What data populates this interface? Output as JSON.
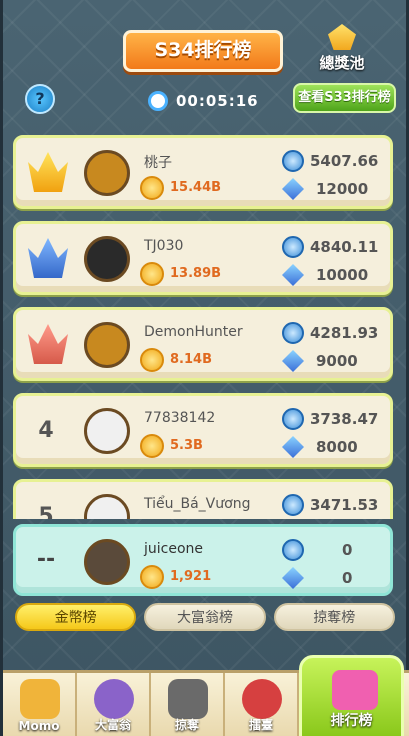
{
  "header": {
    "title": "S34排行榜",
    "pool_label": "總獎池",
    "help_label": "?",
    "timer": "00:05:16",
    "view_button": "查看S33排行榜"
  },
  "rows": [
    {
      "rank": "",
      "crown": "gold",
      "name": "桃子",
      "gold": "15.44B",
      "score": "5407.66",
      "gems": "12000",
      "avatar_color": "#c8891f"
    },
    {
      "rank": "",
      "crown": "silver",
      "name": "TJ030",
      "gold": "13.89B",
      "score": "4840.11",
      "gems": "10000",
      "avatar_color": "#2a2a2a"
    },
    {
      "rank": "",
      "crown": "bronze",
      "name": "DemonHunter",
      "gold": "8.14B",
      "score": "4281.93",
      "gems": "9000",
      "avatar_color": "#c8891f"
    },
    {
      "rank": "4",
      "crown": "",
      "name": "77838142",
      "gold": "5.3B",
      "score": "3738.47",
      "gems": "8000",
      "avatar_color": "#f0f0f0"
    },
    {
      "rank": "5",
      "crown": "",
      "name": "Tiểu_Bá_Vương",
      "gold": "",
      "score": "3471.53",
      "gems": "",
      "avatar_color": "#f0f0f0"
    }
  ],
  "self": {
    "rank": "--",
    "name": "juiceone",
    "gold": "1,921",
    "score": "0",
    "gems": "0"
  },
  "tabs": [
    {
      "label": "金幣榜",
      "active": true
    },
    {
      "label": "大富翁榜",
      "active": false
    },
    {
      "label": "掠奪榜",
      "active": false
    }
  ],
  "nav": [
    {
      "label": "Momo",
      "color": "#f0b43a"
    },
    {
      "label": "大富翁",
      "color": "#8a63c9"
    },
    {
      "label": "掠奪",
      "color": "#6a6a6a"
    },
    {
      "label": "擂臺",
      "color": "#d64040"
    },
    {
      "label": "排行榜",
      "color": "#f060b0"
    }
  ]
}
